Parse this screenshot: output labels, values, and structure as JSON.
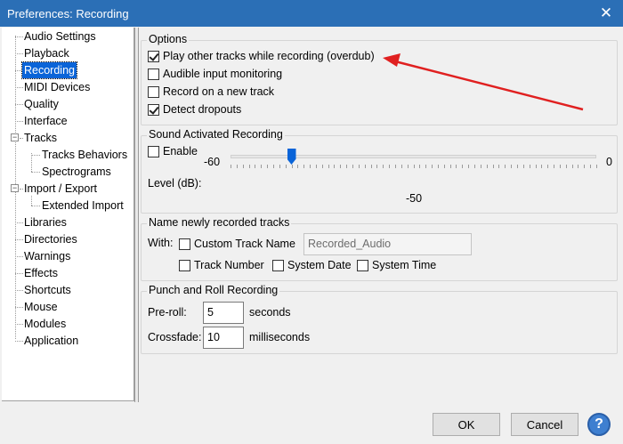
{
  "window": {
    "title": "Preferences: Recording"
  },
  "tree": {
    "items": [
      {
        "label": "Audio Settings"
      },
      {
        "label": "Playback"
      },
      {
        "label": "Recording"
      },
      {
        "label": "MIDI Devices"
      },
      {
        "label": "Quality"
      },
      {
        "label": "Interface"
      },
      {
        "label": "Tracks"
      },
      {
        "label": "Tracks Behaviors"
      },
      {
        "label": "Spectrograms"
      },
      {
        "label": "Import / Export"
      },
      {
        "label": "Extended Import"
      },
      {
        "label": "Libraries"
      },
      {
        "label": "Directories"
      },
      {
        "label": "Warnings"
      },
      {
        "label": "Effects"
      },
      {
        "label": "Shortcuts"
      },
      {
        "label": "Mouse"
      },
      {
        "label": "Modules"
      },
      {
        "label": "Application"
      }
    ],
    "selected": "Recording"
  },
  "options": {
    "label": "Options",
    "play_other": {
      "label": "Play other tracks while recording (overdub)",
      "checked": true
    },
    "audible": {
      "label": "Audible input monitoring",
      "checked": false
    },
    "new_track": {
      "label": "Record on a new track",
      "checked": false
    },
    "dropouts": {
      "label": "Detect dropouts",
      "checked": true
    }
  },
  "sound_activated": {
    "label": "Sound Activated Recording",
    "enable": {
      "label": "Enable",
      "checked": false
    },
    "level_label": "Level (dB):",
    "min_label": "-60",
    "max_label": "0",
    "value_label": "-50",
    "level_value": -50,
    "level_min": -60,
    "level_max": 0
  },
  "naming": {
    "label": "Name newly recorded tracks",
    "with_label": "With:",
    "custom_name": {
      "label": "Custom Track Name",
      "checked": false
    },
    "custom_name_value": "Recorded_Audio",
    "track_number": {
      "label": "Track Number",
      "checked": false
    },
    "system_date": {
      "label": "System Date",
      "checked": false
    },
    "system_time": {
      "label": "System Time",
      "checked": false
    }
  },
  "punch_roll": {
    "label": "Punch and Roll Recording",
    "preroll_label": "Pre-roll:",
    "preroll_value": "5",
    "preroll_unit": "seconds",
    "crossfade_label": "Crossfade:",
    "crossfade_value": "10",
    "crossfade_unit": "milliseconds"
  },
  "buttons": {
    "ok": "OK",
    "cancel": "Cancel",
    "help": "?"
  },
  "colors": {
    "titlebar": "#2b6fb6",
    "selection": "#0a64d8",
    "annotation_arrow": "#e02020"
  }
}
